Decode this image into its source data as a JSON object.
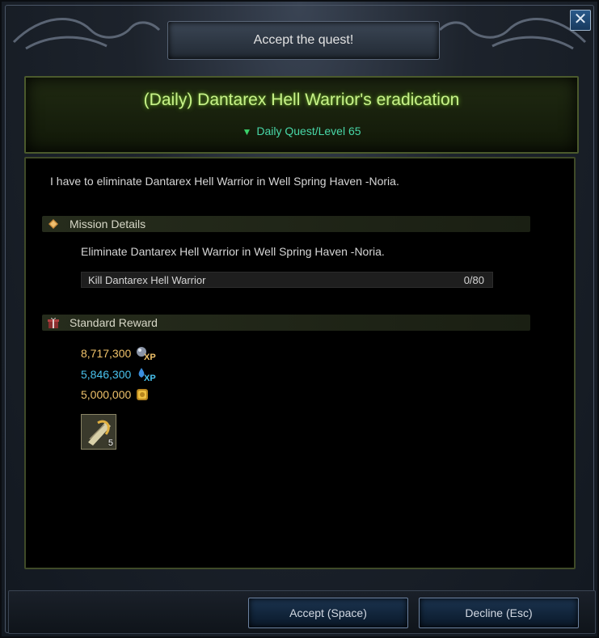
{
  "window": {
    "title": "Accept the quest!",
    "close_icon": "close-icon"
  },
  "quest": {
    "title": "(Daily) Dantarex Hell Warrior's eradication",
    "subtitle": "Daily Quest/Level 65",
    "description": "I have to eliminate Dantarex Hell Warrior in Well Spring Haven -Noria."
  },
  "mission": {
    "header": "Mission Details",
    "text": "Eliminate Dantarex Hell Warrior in Well Spring Haven -Noria.",
    "objective": {
      "label": "Kill Dantarex Hell Warrior",
      "progress": "0/80"
    }
  },
  "rewards": {
    "header": "Standard Reward",
    "xp_amount": "8,717,300",
    "xp_label": "XP",
    "skill_xp_amount": "5,846,300",
    "skill_xp_label": "XP",
    "gold_amount": "5,000,000",
    "item": {
      "icon": "scroll-item-icon",
      "count": "5"
    }
  },
  "buttons": {
    "accept": "Accept (Space)",
    "decline": "Decline (Esc)"
  },
  "colors": {
    "title_green": "#c8f28a",
    "subtitle_teal": "#48d7a8",
    "xp_gold": "#f0c26a",
    "xp_blue": "#49c3ef"
  }
}
